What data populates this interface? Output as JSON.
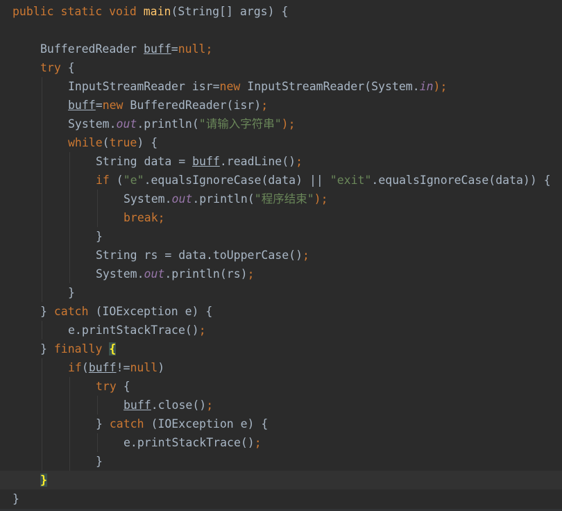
{
  "editor": {
    "lines": [
      {
        "indent": 0,
        "current": false,
        "tokens": [
          {
            "t": "public static void ",
            "c": "kw"
          },
          {
            "t": "main",
            "c": "fn"
          },
          {
            "t": "(String[] args) {",
            "c": "plain"
          }
        ]
      },
      {
        "indent": 0,
        "current": false,
        "tokens": []
      },
      {
        "indent": 1,
        "current": false,
        "tokens": [
          {
            "t": "BufferedReader ",
            "c": "plain"
          },
          {
            "t": "buff",
            "c": "ul"
          },
          {
            "t": "=",
            "c": "plain"
          },
          {
            "t": "null",
            "c": "kw"
          },
          {
            "t": ";",
            "c": "punc"
          }
        ]
      },
      {
        "indent": 1,
        "current": false,
        "tokens": [
          {
            "t": "try",
            "c": "kw"
          },
          {
            "t": " {",
            "c": "plain"
          }
        ]
      },
      {
        "indent": 2,
        "current": false,
        "tokens": [
          {
            "t": "InputStreamReader isr=",
            "c": "plain"
          },
          {
            "t": "new",
            "c": "kw"
          },
          {
            "t": " InputStreamReader(System.",
            "c": "plain"
          },
          {
            "t": "in",
            "c": "field"
          },
          {
            "t": ");",
            "c": "punc"
          }
        ]
      },
      {
        "indent": 2,
        "current": false,
        "tokens": [
          {
            "t": "buff",
            "c": "ul"
          },
          {
            "t": "=",
            "c": "plain"
          },
          {
            "t": "new",
            "c": "kw"
          },
          {
            "t": " BufferedReader(isr)",
            "c": "plain"
          },
          {
            "t": ";",
            "c": "punc"
          }
        ]
      },
      {
        "indent": 2,
        "current": false,
        "tokens": [
          {
            "t": "System.",
            "c": "plain"
          },
          {
            "t": "out",
            "c": "field"
          },
          {
            "t": ".println(",
            "c": "plain"
          },
          {
            "t": "\"请输入字符串\"",
            "c": "str"
          },
          {
            "t": ");",
            "c": "punc"
          }
        ]
      },
      {
        "indent": 2,
        "current": false,
        "tokens": [
          {
            "t": "while",
            "c": "kw"
          },
          {
            "t": "(",
            "c": "plain"
          },
          {
            "t": "true",
            "c": "kw"
          },
          {
            "t": ") {",
            "c": "plain"
          }
        ]
      },
      {
        "indent": 3,
        "current": false,
        "tokens": [
          {
            "t": "String data = ",
            "c": "plain"
          },
          {
            "t": "buff",
            "c": "ul"
          },
          {
            "t": ".readLine()",
            "c": "plain"
          },
          {
            "t": ";",
            "c": "punc"
          }
        ]
      },
      {
        "indent": 3,
        "current": false,
        "tokens": [
          {
            "t": "if",
            "c": "kw"
          },
          {
            "t": " (",
            "c": "plain"
          },
          {
            "t": "\"e\"",
            "c": "str"
          },
          {
            "t": ".equalsIgnoreCase(data) || ",
            "c": "plain"
          },
          {
            "t": "\"exit\"",
            "c": "str"
          },
          {
            "t": ".equalsIgnoreCase(data)) {",
            "c": "plain"
          }
        ]
      },
      {
        "indent": 4,
        "current": false,
        "tokens": [
          {
            "t": "System.",
            "c": "plain"
          },
          {
            "t": "out",
            "c": "field"
          },
          {
            "t": ".println(",
            "c": "plain"
          },
          {
            "t": "\"程序结束\"",
            "c": "str"
          },
          {
            "t": ");",
            "c": "punc"
          }
        ]
      },
      {
        "indent": 4,
        "current": false,
        "tokens": [
          {
            "t": "break",
            "c": "kw"
          },
          {
            "t": ";",
            "c": "punc"
          }
        ]
      },
      {
        "indent": 3,
        "current": false,
        "tokens": [
          {
            "t": "}",
            "c": "plain"
          }
        ]
      },
      {
        "indent": 3,
        "current": false,
        "tokens": [
          {
            "t": "String rs = data.toUpperCase()",
            "c": "plain"
          },
          {
            "t": ";",
            "c": "punc"
          }
        ]
      },
      {
        "indent": 3,
        "current": false,
        "tokens": [
          {
            "t": "System.",
            "c": "plain"
          },
          {
            "t": "out",
            "c": "field"
          },
          {
            "t": ".println(rs)",
            "c": "plain"
          },
          {
            "t": ";",
            "c": "punc"
          }
        ]
      },
      {
        "indent": 2,
        "current": false,
        "tokens": [
          {
            "t": "}",
            "c": "plain"
          }
        ]
      },
      {
        "indent": 1,
        "current": false,
        "tokens": [
          {
            "t": "} ",
            "c": "plain"
          },
          {
            "t": "catch",
            "c": "kw"
          },
          {
            "t": " (IOException e) {",
            "c": "plain"
          }
        ]
      },
      {
        "indent": 2,
        "current": false,
        "tokens": [
          {
            "t": "e.printStackTrace()",
            "c": "plain"
          },
          {
            "t": ";",
            "c": "punc"
          }
        ]
      },
      {
        "indent": 1,
        "current": false,
        "tokens": [
          {
            "t": "} ",
            "c": "plain"
          },
          {
            "t": "finally",
            "c": "kw"
          },
          {
            "t": " ",
            "c": "plain"
          },
          {
            "t": "{",
            "c": "brace-hl"
          }
        ]
      },
      {
        "indent": 2,
        "current": false,
        "tokens": [
          {
            "t": "if",
            "c": "kw"
          },
          {
            "t": "(",
            "c": "plain"
          },
          {
            "t": "buff",
            "c": "ul"
          },
          {
            "t": "!=",
            "c": "plain"
          },
          {
            "t": "null",
            "c": "kw"
          },
          {
            "t": ")",
            "c": "plain"
          }
        ]
      },
      {
        "indent": 3,
        "current": false,
        "tokens": [
          {
            "t": "try",
            "c": "kw"
          },
          {
            "t": " {",
            "c": "plain"
          }
        ]
      },
      {
        "indent": 4,
        "current": false,
        "tokens": [
          {
            "t": "buff",
            "c": "ul"
          },
          {
            "t": ".close()",
            "c": "plain"
          },
          {
            "t": ";",
            "c": "punc"
          }
        ]
      },
      {
        "indent": 3,
        "current": false,
        "tokens": [
          {
            "t": "} ",
            "c": "plain"
          },
          {
            "t": "catch",
            "c": "kw"
          },
          {
            "t": " (IOException e) {",
            "c": "plain"
          }
        ]
      },
      {
        "indent": 4,
        "current": false,
        "tokens": [
          {
            "t": "e.printStackTrace()",
            "c": "plain"
          },
          {
            "t": ";",
            "c": "punc"
          }
        ]
      },
      {
        "indent": 3,
        "current": false,
        "tokens": [
          {
            "t": "}",
            "c": "plain"
          }
        ]
      },
      {
        "indent": 1,
        "current": true,
        "tokens": [
          {
            "t": "}",
            "c": "brace-hl"
          }
        ]
      },
      {
        "indent": 0,
        "current": false,
        "tokens": [
          {
            "t": "}",
            "c": "plain"
          }
        ]
      }
    ]
  },
  "theme": {
    "background": "#2b2b2b",
    "current_line": "#323232",
    "keyword": "#cc7832",
    "method": "#ffc66d",
    "string": "#6a8759",
    "static_field": "#9876aa",
    "default_text": "#a9b7c6",
    "brace_match": "#ffef28"
  }
}
